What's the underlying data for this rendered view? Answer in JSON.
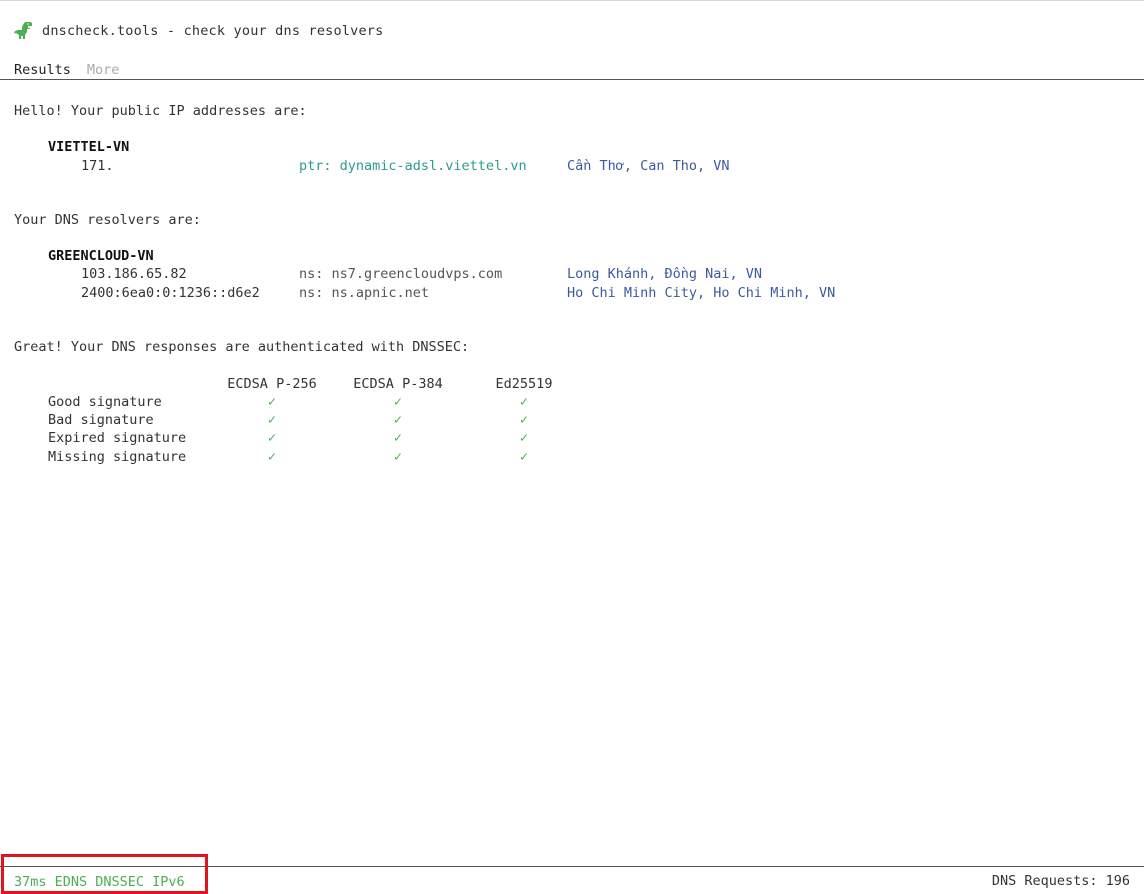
{
  "header": {
    "title": "dnscheck.tools - check your dns resolvers",
    "logo_icon": "dinosaur-icon",
    "logo_color": "#4caf50"
  },
  "nav": {
    "items": [
      {
        "label": "Results",
        "active": true
      },
      {
        "label": "More",
        "active": false
      }
    ]
  },
  "public_ip": {
    "intro": "Hello! Your public IP addresses are:",
    "org": "VIETTEL-VN",
    "entries": [
      {
        "ip": "171.",
        "host": "ptr: dynamic-adsl.viettel.vn",
        "location": "Cần Thơ, Can Tho, VN"
      }
    ]
  },
  "resolvers": {
    "intro": "Your DNS resolvers are:",
    "org": "GREENCLOUD-VN",
    "entries": [
      {
        "ip": "103.186.65.82",
        "host": "ns: ns7.greencloudvps.com",
        "location": "Long Khánh, Đồng Nai, VN"
      },
      {
        "ip": "2400:6ea0:0:1236::d6e2",
        "host": "ns: ns.apnic.net",
        "location": "Ho Chi Minh City, Ho Chi Minh, VN"
      }
    ]
  },
  "dnssec": {
    "intro": "Great! Your DNS responses are authenticated with DNSSEC:",
    "columns": [
      "ECDSA P-256",
      "ECDSA P-384",
      "Ed25519"
    ],
    "rows": [
      {
        "label": "Good signature",
        "checks": [
          "✓",
          "✓",
          "✓"
        ]
      },
      {
        "label": "Bad signature",
        "checks": [
          "✓",
          "✓",
          "✓"
        ]
      },
      {
        "label": "Expired signature",
        "checks": [
          "✓",
          "✓",
          "✓"
        ]
      },
      {
        "label": "Missing signature",
        "checks": [
          "✓",
          "✓",
          "✓"
        ]
      }
    ],
    "check_color": "#4caf50"
  },
  "footer": {
    "features": "37ms EDNS DNSSEC IPv6",
    "requests": "DNS Requests: 196",
    "highlight_color": "#e0141e"
  }
}
